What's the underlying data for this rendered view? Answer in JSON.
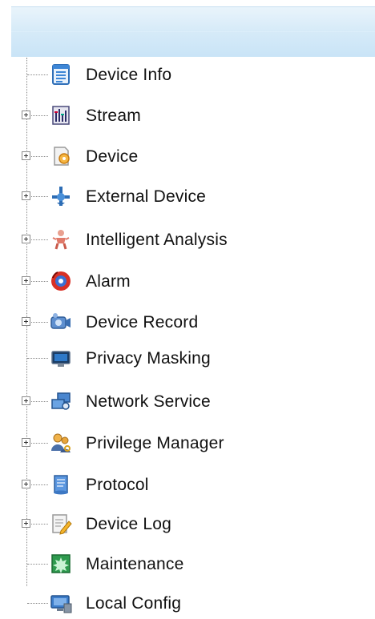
{
  "colors": {
    "header_top": "#e9f4fb",
    "header_bottom": "#c9e4f7",
    "tree_line": "#8a8a8a"
  },
  "menu": {
    "items": [
      {
        "label": "Device Info",
        "icon": "document-icon",
        "expandable": false
      },
      {
        "label": "Stream",
        "icon": "stream-icon",
        "expandable": true
      },
      {
        "label": "Device",
        "icon": "device-config-icon",
        "expandable": true
      },
      {
        "label": "External Device",
        "icon": "external-device-icon",
        "expandable": true
      },
      {
        "label": "Intelligent Analysis",
        "icon": "intelligent-analysis-icon",
        "expandable": true
      },
      {
        "label": "Alarm",
        "icon": "alarm-icon",
        "expandable": true
      },
      {
        "label": "Device Record",
        "icon": "camera-record-icon",
        "expandable": true
      },
      {
        "label": "Privacy Masking",
        "icon": "monitor-icon",
        "expandable": false
      },
      {
        "label": "Network Service",
        "icon": "network-icon",
        "expandable": true
      },
      {
        "label": "Privilege Manager",
        "icon": "users-key-icon",
        "expandable": true
      },
      {
        "label": "Protocol",
        "icon": "scroll-icon",
        "expandable": true
      },
      {
        "label": "Device Log",
        "icon": "log-pencil-icon",
        "expandable": true
      },
      {
        "label": "Maintenance",
        "icon": "maintenance-icon",
        "expandable": false
      },
      {
        "label": "Local Config",
        "icon": "computer-icon",
        "expandable": false
      }
    ]
  }
}
